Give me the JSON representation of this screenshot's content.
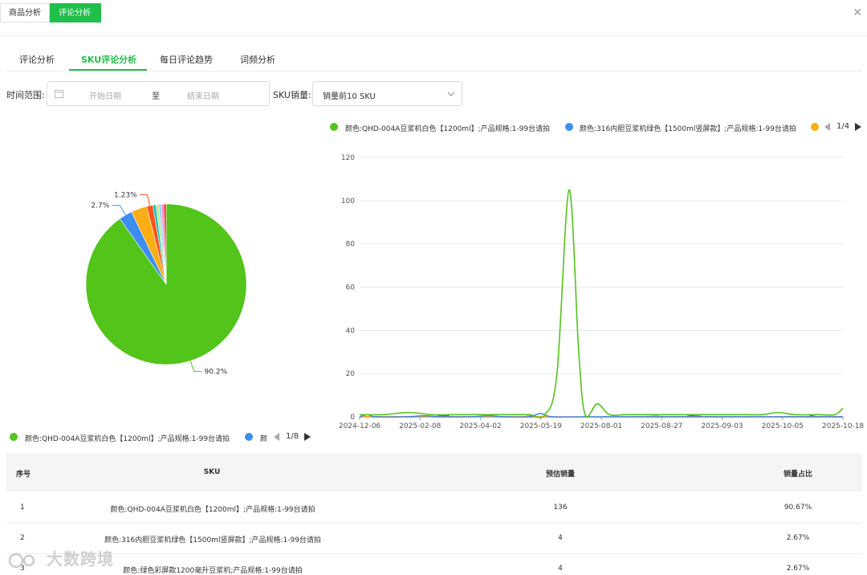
{
  "top_tabs": [
    {
      "label": "商品分析",
      "active": false
    },
    {
      "label": "评论分析",
      "active": true
    }
  ],
  "close_icon": "close-icon",
  "sub_tabs": [
    {
      "label": "评论分析",
      "active": false
    },
    {
      "label": "SKU评论分析",
      "active": true
    },
    {
      "label": "每日评论趋势",
      "active": false
    },
    {
      "label": "词频分析",
      "active": false
    }
  ],
  "filters": {
    "time_label": "时间范围:",
    "start_placeholder": "开始日期",
    "range_sep": "至",
    "end_placeholder": "结束日期",
    "sku_label": "SKU销量:",
    "sku_select_value": "销量前10 SKU"
  },
  "colors": {
    "accent": "#1fbf4a",
    "green": "#52c41a",
    "blue": "#3d8ef0",
    "orange": "#faad14",
    "red": "#f5222d"
  },
  "line_legend": {
    "items": [
      {
        "label": "颜色:QHD-004A豆浆机白色【1200ml】;产品规格:1-99台请拍",
        "color": "#52c41a"
      },
      {
        "label": "颜色:316内胆豆浆机绿色【1500ml竖屏款】;产品规格:1-99台请拍",
        "color": "#3d8ef0"
      },
      {
        "label": "",
        "color": "#faad14"
      }
    ],
    "page": "1/4"
  },
  "pie_legend": {
    "items": [
      {
        "label": "颜色:QHD-004A豆浆机白色【1200ml】;产品规格:1-99台请拍",
        "color": "#52c41a"
      },
      {
        "label": "颜",
        "color": "#3d8ef0"
      }
    ],
    "page": "1/8"
  },
  "chart_data": [
    {
      "type": "pie",
      "slices": [
        {
          "value": 90.2,
          "color": "#52c41a",
          "label": "90.2%"
        },
        {
          "value": 2.7,
          "color": "#3d8ef0",
          "label": "2.7%"
        },
        {
          "value": 3.2,
          "color": "#faad14",
          "label": ""
        },
        {
          "value": 1.23,
          "color": "#fa541c",
          "label": "1.23%"
        },
        {
          "value": 0.6,
          "color": "#13c2c2",
          "label": ""
        },
        {
          "value": 0.6,
          "color": "#b7eb8f",
          "label": ""
        },
        {
          "value": 0.5,
          "color": "#91d5ff",
          "label": ""
        },
        {
          "value": 0.5,
          "color": "#ff85c0",
          "label": ""
        },
        {
          "value": 0.47,
          "color": "#f5222d",
          "label": ""
        }
      ]
    },
    {
      "type": "line",
      "x_ticks": [
        "2024-12-06",
        "2025-02-08",
        "2025-04-02",
        "2025-05-19",
        "2025-08-01",
        "2025-08-27",
        "2025-09-03",
        "2025-10-05",
        "2025-10-18"
      ],
      "y_ticks": [
        "0",
        "20",
        "40",
        "60",
        "80",
        "100",
        "120"
      ],
      "ylim": [
        0,
        120
      ],
      "x_range": [
        0,
        60
      ],
      "series": [
        {
          "name": "颜色:QHD-004A豆浆机白色【1200ml】;产品规格:1-99台请拍",
          "color": "#52c41a",
          "points": [
            [
              0,
              1
            ],
            [
              3,
              1
            ],
            [
              6,
              2
            ],
            [
              9,
              1
            ],
            [
              12,
              1
            ],
            [
              15,
              1
            ],
            [
              18,
              1
            ],
            [
              21,
              1
            ],
            [
              23,
              1
            ],
            [
              24.5,
              20
            ],
            [
              26,
              105
            ],
            [
              27.2,
              30
            ],
            [
              28,
              1
            ],
            [
              29.5,
              6
            ],
            [
              31,
              1
            ],
            [
              33,
              1
            ],
            [
              36,
              1
            ],
            [
              39,
              1
            ],
            [
              42,
              1
            ],
            [
              45,
              1
            ],
            [
              48,
              1
            ],
            [
              50,
              1
            ],
            [
              52,
              2
            ],
            [
              54,
              1
            ],
            [
              57,
              1
            ],
            [
              59,
              1
            ],
            [
              60,
              4
            ]
          ]
        },
        {
          "name": "颜色:316内胆豆浆机绿色【1500ml竖屏款】;产品规格:1-99台请拍",
          "color": "#3d8ef0",
          "points": [
            [
              0,
              0
            ],
            [
              1,
              1
            ],
            [
              2,
              0
            ],
            [
              6,
              0
            ],
            [
              8,
              0.5
            ],
            [
              10,
              0
            ],
            [
              14,
              0
            ],
            [
              16,
              0.5
            ],
            [
              18,
              0
            ],
            [
              21,
              0
            ],
            [
              22.5,
              1.5
            ],
            [
              24,
              0
            ],
            [
              30,
              0
            ],
            [
              60,
              0
            ]
          ]
        },
        {
          "name": "",
          "color": "#faad14",
          "points": [
            [
              0,
              0
            ],
            [
              20,
              0
            ],
            [
              21,
              0.5
            ],
            [
              22,
              0
            ],
            [
              35,
              0
            ],
            [
              37,
              1
            ],
            [
              39,
              0
            ],
            [
              60,
              0
            ]
          ]
        },
        {
          "name": "",
          "color": "#f5222d",
          "points": [
            [
              0,
              0
            ],
            [
              10,
              0
            ],
            [
              11,
              0.6
            ],
            [
              12,
              0
            ],
            [
              40,
              0
            ],
            [
              41,
              0.5
            ],
            [
              42,
              0
            ],
            [
              55,
              0
            ],
            [
              56,
              0.5
            ],
            [
              57,
              0
            ],
            [
              60,
              0
            ]
          ]
        }
      ]
    }
  ],
  "table": {
    "headers": [
      "序号",
      "SKU",
      "预估销量",
      "销量占比"
    ],
    "rows": [
      [
        "1",
        "颜色:QHD-004A豆浆机白色【1200ml】;产品规格:1-99台请拍",
        "136",
        "90.67%"
      ],
      [
        "2",
        "颜色:316内胆豆浆机绿色【1500ml竖屏款】;产品规格:1-99台请拍",
        "4",
        "2.67%"
      ],
      [
        "3",
        "颜色:绿色彩屏款1200毫升豆浆机;产品规格:1-99台请拍",
        "4",
        "2.67%"
      ]
    ]
  },
  "watermark": "大数跨境"
}
